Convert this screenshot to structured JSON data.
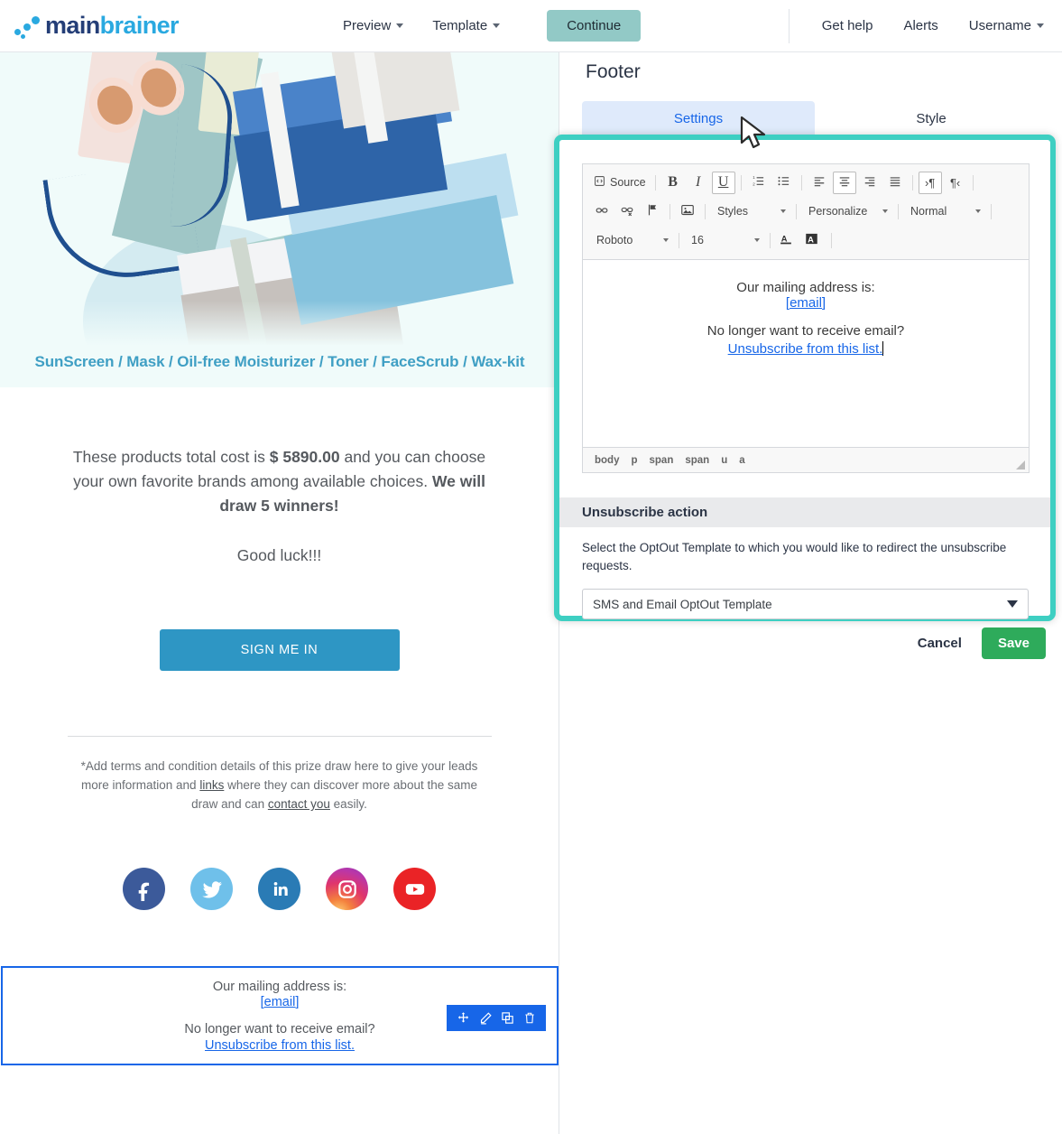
{
  "topnav": {
    "logo": {
      "word1": "main",
      "word2": "brainer"
    },
    "links": [
      {
        "label": "Preview",
        "has_caret": true
      },
      {
        "label": "Template",
        "has_caret": true
      }
    ],
    "continue_label": "Continue",
    "right_links": [
      {
        "label": "Get help",
        "has_caret": false
      },
      {
        "label": "Alerts",
        "has_caret": false
      },
      {
        "label": "Username",
        "has_caret": true
      }
    ],
    "continue_color": "#92c9c6"
  },
  "email_preview": {
    "hero_headline": "SunScreen / Mask / Oil-free Moisturizer / Toner / FaceScrub / Wax-kit",
    "hero_bg": "#f0fbfa",
    "hero_text_color": "#3f9fc4",
    "paragraph_1_a": "These products total cost is ",
    "paragraph_1_bold": "$ 5890.00",
    "paragraph_1_b": " and you can choose your own favorite brands among available choices. ",
    "paragraph_1_bold2": "We will draw 5 winners!",
    "paragraph_2": "Good luck!!!",
    "signin_label": "SIGN ME IN",
    "signin_color": "#2e96c4",
    "terms_a": "*Add terms and condition details of this prize draw here to give your leads more information and ",
    "terms_link1": "links",
    "terms_b": " where they can discover more about the same draw and can ",
    "terms_link2": "contact you",
    "terms_c": " easily.",
    "socials": [
      {
        "name": "facebook",
        "color": "#3c5a9a"
      },
      {
        "name": "twitter",
        "color": "#6fc0ea"
      },
      {
        "name": "linkedin",
        "color": "#2a7bb5"
      },
      {
        "name": "instagram",
        "color": "#e0356b"
      },
      {
        "name": "youtube",
        "color": "#ea2326"
      }
    ],
    "footer_block": {
      "line1": "Our mailing address is:",
      "email": "[email]",
      "line2": "No longer want to receive email?",
      "unsubscribe": "Unsubscribe from this list.",
      "selection_color": "#1766e8",
      "toolbar_icons": [
        "move-icon",
        "edit-icon",
        "duplicate-icon",
        "delete-icon"
      ]
    }
  },
  "settings": {
    "panel_title": "Footer",
    "tabs": [
      {
        "label": "Settings",
        "active": true
      },
      {
        "label": "Style",
        "active": false
      }
    ],
    "highlight_color": "#3ecfc2",
    "editor": {
      "toolbar_row1": [
        {
          "name": "source-button",
          "label": "Source",
          "icon": "source-icon",
          "active": false
        },
        {
          "name": "bold-button",
          "label": "B",
          "active": false
        },
        {
          "name": "italic-button",
          "label": "I",
          "active": false
        },
        {
          "name": "underline-button",
          "label": "U",
          "active": true
        },
        {
          "name": "numbered-list-button",
          "icon": "ordered-list-icon",
          "active": false
        },
        {
          "name": "bulleted-list-button",
          "icon": "unordered-list-icon",
          "active": false
        },
        {
          "name": "align-left-button",
          "icon": "align-left-icon",
          "active": false
        },
        {
          "name": "align-center-button",
          "icon": "align-center-icon",
          "active": true
        },
        {
          "name": "align-right-button",
          "icon": "align-right-icon",
          "active": false
        },
        {
          "name": "align-justify-button",
          "icon": "align-justify-icon",
          "active": false
        },
        {
          "name": "ltr-button",
          "icon": "text-direction-ltr-icon",
          "active": true
        },
        {
          "name": "rtl-button",
          "icon": "text-direction-rtl-icon",
          "active": false
        }
      ],
      "toolbar_row2_icons": [
        {
          "name": "link-button",
          "icon": "link-icon"
        },
        {
          "name": "unlink-button",
          "icon": "unlink-icon"
        },
        {
          "name": "anchor-button",
          "icon": "flag-icon"
        },
        {
          "name": "image-button",
          "icon": "image-icon"
        }
      ],
      "styles_label": "Styles",
      "personalize_label": "Personalize",
      "format_label": "Normal",
      "font_label": "Roboto",
      "fontsize_label": "16",
      "text_color_icon": "text-color-icon",
      "bg_color_icon": "background-color-icon",
      "content": {
        "line1": "Our mailing address is:",
        "email": "[email]",
        "line2": "No longer want to receive email?",
        "unsubscribe": "Unsubscribe from this list."
      },
      "elements_path": [
        "body",
        "p",
        "span",
        "span",
        "u",
        "a"
      ]
    },
    "unsubscribe_action": {
      "header": "Unsubscribe action",
      "description": "Select the OptOut Template to which you would like to redirect the unsubscribe requests.",
      "selected_template": "SMS and Email OptOut Template"
    },
    "cancel_label": "Cancel",
    "save_label": "Save",
    "save_color": "#2eab5b"
  }
}
